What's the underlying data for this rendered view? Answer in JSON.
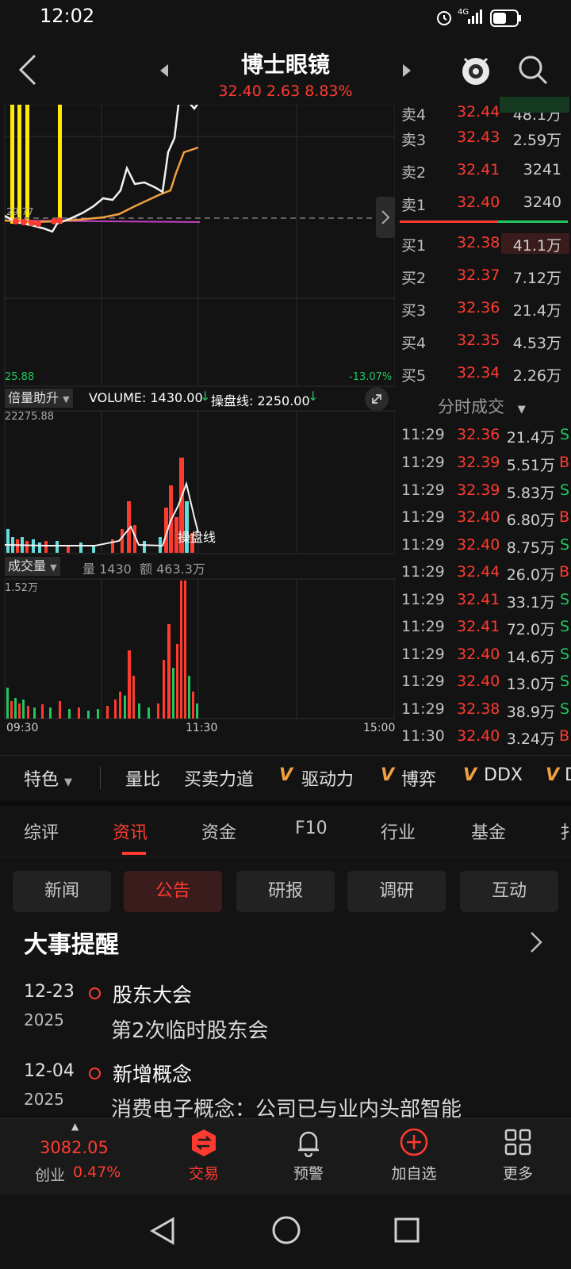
{
  "status_bar": {
    "time": "12:02",
    "network": "4G"
  },
  "header": {
    "title": "博士眼镜",
    "quote": "32.40 2.63 8.83%"
  },
  "chart": {
    "price_low_label": "25.88",
    "pct_low_label": "-13.07%",
    "ref_label": "29.77",
    "volume_panel": {
      "indicator": "倍量助升",
      "volume_text": "VOLUME: 1430.00",
      "line_text": "操盘线: 2250.00",
      "max_label": "22275.88",
      "line_name": "操盘线"
    },
    "turnover_panel": {
      "indicator": "成交量",
      "amount_text": "量 1430",
      "value_text": "额 463.3万",
      "max_label": "1.52万"
    },
    "time_start": "09:30",
    "time_mid": "11:30",
    "time_end": "15:00"
  },
  "order_book": {
    "asks": [
      {
        "label": "卖4",
        "price": "32.44",
        "vol": "48.1万"
      },
      {
        "label": "卖3",
        "price": "32.43",
        "vol": "2.59万"
      },
      {
        "label": "卖2",
        "price": "32.41",
        "vol": "3241"
      },
      {
        "label": "卖1",
        "price": "32.40",
        "vol": "3240"
      }
    ],
    "bids": [
      {
        "label": "买1",
        "price": "32.38",
        "vol": "41.1万"
      },
      {
        "label": "买2",
        "price": "32.37",
        "vol": "7.12万"
      },
      {
        "label": "买3",
        "price": "32.36",
        "vol": "21.4万"
      },
      {
        "label": "买4",
        "price": "32.35",
        "vol": "4.53万"
      },
      {
        "label": "买5",
        "price": "32.34",
        "vol": "2.26万"
      }
    ]
  },
  "trades": {
    "header": "分时成交",
    "rows": [
      {
        "time": "11:29",
        "price": "32.36",
        "vol": "21.4万",
        "side": "S"
      },
      {
        "time": "11:29",
        "price": "32.39",
        "vol": "5.51万",
        "side": "B"
      },
      {
        "time": "11:29",
        "price": "32.39",
        "vol": "5.83万",
        "side": "S"
      },
      {
        "time": "11:29",
        "price": "32.40",
        "vol": "6.80万",
        "side": "B"
      },
      {
        "time": "11:29",
        "price": "32.40",
        "vol": "8.75万",
        "side": "S"
      },
      {
        "time": "11:29",
        "price": "32.44",
        "vol": "26.0万",
        "side": "B"
      },
      {
        "time": "11:29",
        "price": "32.41",
        "vol": "33.1万",
        "side": "S"
      },
      {
        "time": "11:29",
        "price": "32.41",
        "vol": "72.0万",
        "side": "S"
      },
      {
        "time": "11:29",
        "price": "32.40",
        "vol": "14.6万",
        "side": "S"
      },
      {
        "time": "11:29",
        "price": "32.40",
        "vol": "13.0万",
        "side": "S"
      },
      {
        "time": "11:29",
        "price": "32.38",
        "vol": "38.9万",
        "side": "S"
      },
      {
        "time": "11:30",
        "price": "32.40",
        "vol": "3.24万",
        "side": "B"
      }
    ]
  },
  "feature_bar": {
    "dropdown": "特色",
    "items": [
      "量比",
      "买卖力道",
      "驱动力",
      "博弈",
      "DDX",
      "D"
    ]
  },
  "main_tabs": [
    "综评",
    "资讯",
    "资金",
    "F10",
    "行业",
    "基金",
    "扌"
  ],
  "sub_tabs": [
    "新闻",
    "公告",
    "研报",
    "调研",
    "互动"
  ],
  "events": {
    "heading": "大事提醒",
    "items": [
      {
        "date": "12-23",
        "year": "2025",
        "title": "股东大会",
        "desc": "第2次临时股东会"
      },
      {
        "date": "12-04",
        "year": "2025",
        "title": "新增概念",
        "desc": "消费电子概念：公司已与业内头部智能"
      }
    ]
  },
  "bottom_bar": {
    "index_value": "3082.05",
    "index_name": "创业",
    "index_change": "0.47%",
    "trade": "交易",
    "alert": "预警",
    "add": "加自选",
    "more": "更多"
  },
  "colors": {
    "up": "#ff3b30",
    "down": "#22c55e",
    "bg": "#131313"
  }
}
